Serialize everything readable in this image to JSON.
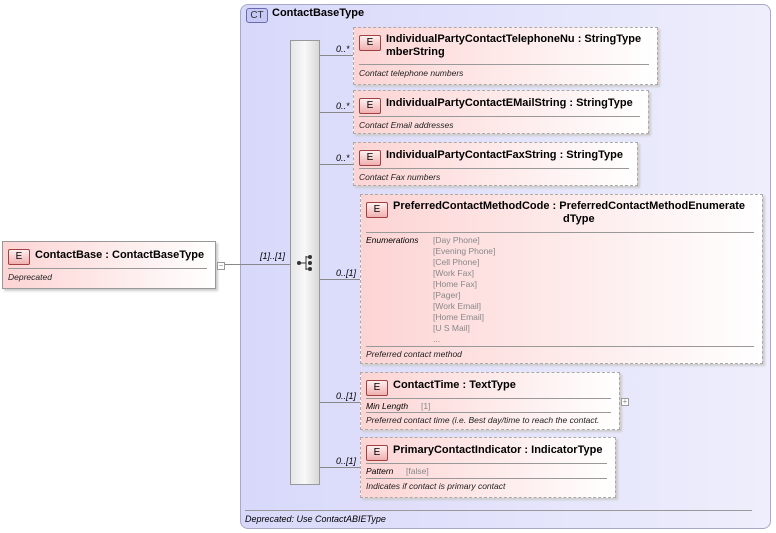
{
  "complex_type": {
    "badge": "CT",
    "name": "ContactBaseType",
    "documentation": "Deprecated: Use ContactABIEType"
  },
  "root": {
    "badge": "E",
    "name": "ContactBase : ContactBaseType",
    "documentation": "Deprecated",
    "cardinality": "[1]..[1]"
  },
  "sequence_icon": "sequence-icon",
  "children": [
    {
      "badge": "E",
      "name": "IndividualPartyContactTelephoneNu : StringType",
      "name2": "mberString",
      "cardinality": "0..*",
      "documentation": "Contact telephone numbers"
    },
    {
      "badge": "E",
      "name": "IndividualPartyContactEMailString : StringType",
      "cardinality": "0..*",
      "documentation": "Contact Email addresses"
    },
    {
      "badge": "E",
      "name": "IndividualPartyContactFaxString : StringType",
      "cardinality": "0..*",
      "documentation": "Contact Fax numbers"
    },
    {
      "badge": "E",
      "name": "PreferredContactMethodCode : PreferredContactMethodEnumerate",
      "name2": "dType",
      "cardinality": "0..[1]",
      "facet_label": "Enumerations",
      "facet_values": "[Day Phone]\n[Evening Phone]\n[Cell Phone]\n[Work Fax]\n[Home Fax]\n[Pager]\n[Work Email]\n[Home Email]\n[U S Mail]\n...",
      "documentation": "Preferred contact method"
    },
    {
      "badge": "E",
      "name": "ContactTime : TextType",
      "cardinality": "0..[1]",
      "facet_label": "Min Length",
      "facet_values": "[1]",
      "documentation": "Preferred contact time (i.e. Best day/time to reach the contact."
    },
    {
      "badge": "E",
      "name": "PrimaryContactIndicator : IndicatorType",
      "cardinality": "0..[1]",
      "facet_label": "Pattern",
      "facet_values": "[false]",
      "documentation": "Indicates if contact is primary contact"
    }
  ]
}
